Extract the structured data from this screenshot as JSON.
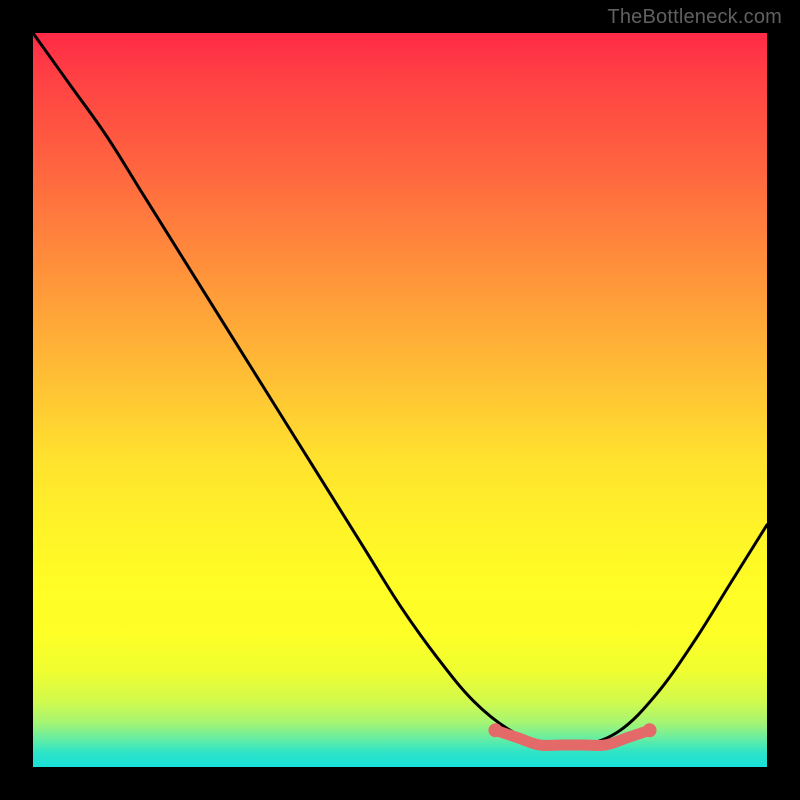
{
  "watermark": "TheBottleneck.com",
  "chart_data": {
    "type": "line",
    "title": "",
    "xlabel": "",
    "ylabel": "",
    "xlim": [
      0,
      100
    ],
    "ylim": [
      0,
      100
    ],
    "background_gradient": {
      "top": "#ff2b47",
      "mid": "#fffd25",
      "bottom": "#18e0d8"
    },
    "curve_color": "#000000",
    "highlight_color": "#e46a6a",
    "series": [
      {
        "name": "curve",
        "x": [
          0,
          5,
          10,
          15,
          20,
          25,
          30,
          35,
          40,
          45,
          50,
          55,
          60,
          65,
          70,
          75,
          80,
          85,
          90,
          95,
          100
        ],
        "y": [
          100,
          93,
          86,
          78,
          70,
          62,
          54,
          46,
          38,
          30,
          22,
          15,
          9,
          5,
          3,
          3,
          5,
          10,
          17,
          25,
          33
        ]
      }
    ],
    "highlight_segment": {
      "x": [
        63,
        66,
        69,
        72,
        75,
        78,
        81,
        84
      ],
      "y": [
        5,
        4,
        3,
        3,
        3,
        3,
        4,
        5
      ]
    }
  }
}
